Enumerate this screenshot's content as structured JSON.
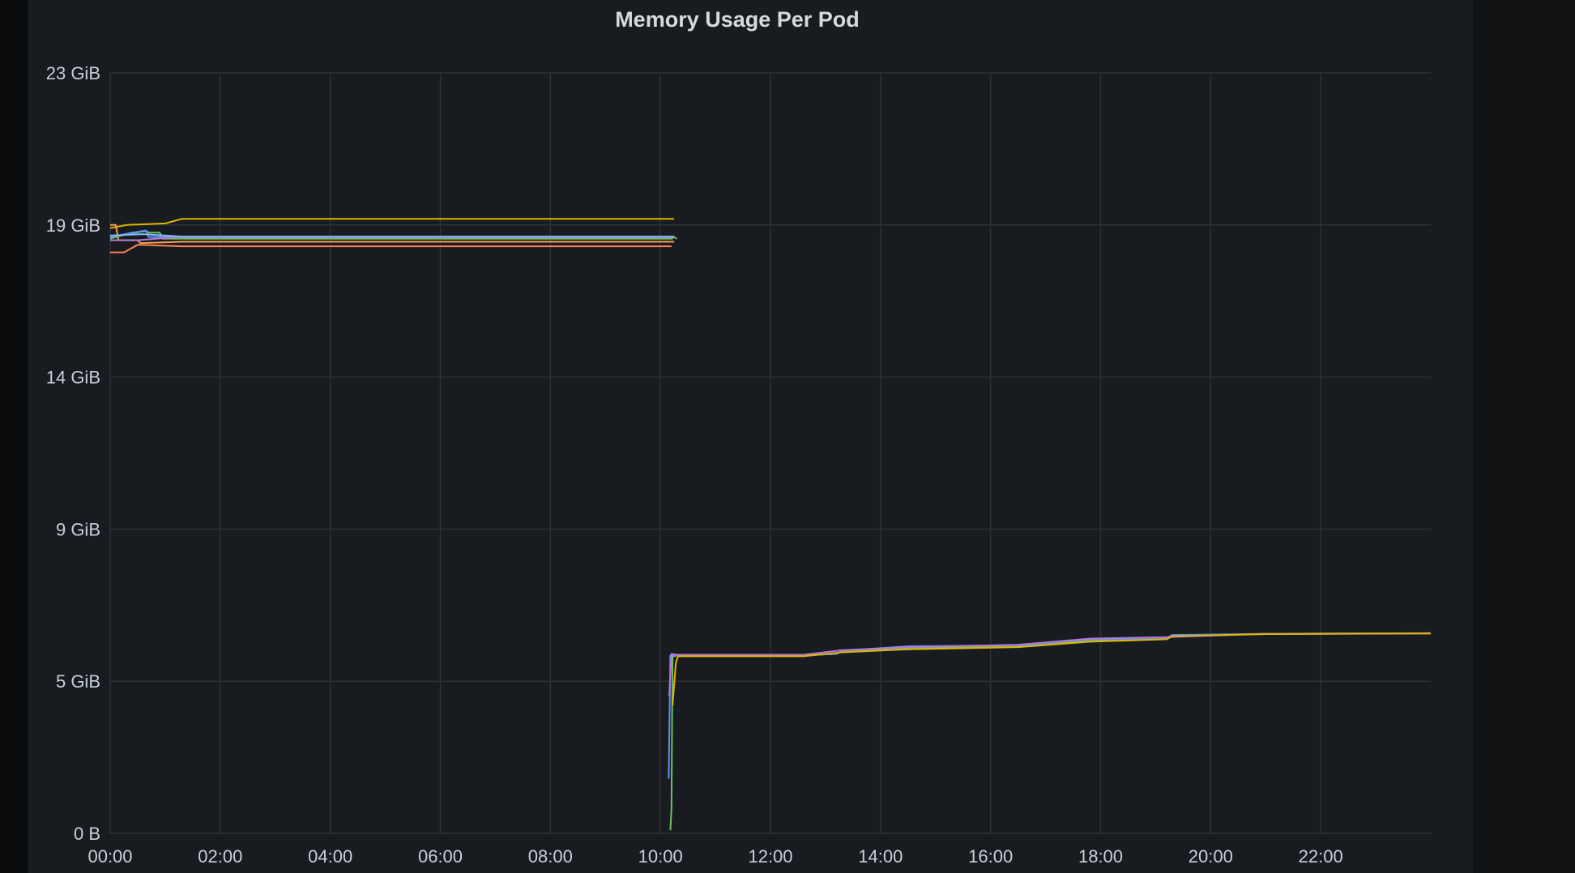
{
  "panel": {
    "title": "Memory Usage Per Pod"
  },
  "colors": {
    "background": "#181b1f",
    "grid": "#2f3136",
    "text": "#c7d0d9"
  },
  "chart_data": {
    "type": "line",
    "title": "Memory Usage Per Pod",
    "xlabel": "",
    "ylabel": "",
    "x_unit": "hours",
    "y_unit": "GiB",
    "xlim": [
      0,
      24
    ],
    "ylim": [
      0,
      25
    ],
    "grid": true,
    "legend": "none",
    "x_ticks": [
      {
        "value": 0,
        "label": "00:00"
      },
      {
        "value": 2,
        "label": "02:00"
      },
      {
        "value": 4,
        "label": "04:00"
      },
      {
        "value": 6,
        "label": "06:00"
      },
      {
        "value": 8,
        "label": "08:00"
      },
      {
        "value": 10,
        "label": "10:00"
      },
      {
        "value": 12,
        "label": "12:00"
      },
      {
        "value": 14,
        "label": "14:00"
      },
      {
        "value": 16,
        "label": "16:00"
      },
      {
        "value": 18,
        "label": "18:00"
      },
      {
        "value": 20,
        "label": "20:00"
      },
      {
        "value": 22,
        "label": "22:00"
      }
    ],
    "y_ticks": [
      {
        "value": 0,
        "label": "0 B"
      },
      {
        "value": 5,
        "label": "5 GiB"
      },
      {
        "value": 10,
        "label": "9 GiB"
      },
      {
        "value": 15,
        "label": "14 GiB"
      },
      {
        "value": 20,
        "label": "19 GiB"
      },
      {
        "value": 25,
        "label": "23 GiB"
      }
    ],
    "series": [
      {
        "color": "#e0b400",
        "points": [
          [
            0,
            19.9
          ],
          [
            0.3,
            20.0
          ],
          [
            1.0,
            20.05
          ],
          [
            1.3,
            20.2
          ],
          [
            10.25,
            20.2
          ]
        ]
      },
      {
        "color": "#f2a052",
        "points": [
          [
            0,
            20.0
          ],
          [
            0.1,
            20.0
          ],
          [
            0.15,
            19.5
          ],
          [
            0.5,
            19.5
          ],
          [
            0.55,
            19.4
          ],
          [
            1.3,
            19.45
          ],
          [
            10.25,
            19.45
          ]
        ]
      },
      {
        "color": "#73bf69",
        "points": [
          [
            0,
            19.55
          ],
          [
            0.3,
            19.7
          ],
          [
            0.65,
            19.8
          ],
          [
            0.7,
            19.75
          ],
          [
            0.9,
            19.75
          ],
          [
            0.95,
            19.55
          ],
          [
            10.2,
            19.55
          ],
          [
            10.25,
            19.6
          ],
          [
            10.3,
            19.55
          ]
        ]
      },
      {
        "color": "#5794f2",
        "points": [
          [
            0,
            19.6
          ],
          [
            0.4,
            19.75
          ],
          [
            0.65,
            19.82
          ],
          [
            0.7,
            19.6
          ],
          [
            1.3,
            19.6
          ],
          [
            10.2,
            19.6
          ]
        ]
      },
      {
        "color": "#b877d9",
        "points": [
          [
            0,
            19.5
          ],
          [
            0.5,
            19.5
          ],
          [
            1.2,
            19.6
          ],
          [
            10.2,
            19.6
          ]
        ]
      },
      {
        "color": "#8ab8ff",
        "points": [
          [
            0,
            19.65
          ],
          [
            0.6,
            19.7
          ],
          [
            1.3,
            19.62
          ],
          [
            10.25,
            19.62
          ]
        ]
      },
      {
        "color": "#ff7f50",
        "points": [
          [
            0,
            19.1
          ],
          [
            0.25,
            19.1
          ],
          [
            0.5,
            19.35
          ],
          [
            1.3,
            19.3
          ],
          [
            10.2,
            19.3
          ]
        ]
      },
      {
        "color": "#73bf69",
        "points": [
          [
            10.18,
            0.1
          ],
          [
            10.2,
            0.8
          ],
          [
            10.22,
            5.8
          ],
          [
            10.3,
            5.85
          ],
          [
            11.5,
            5.85
          ],
          [
            12.6,
            5.85
          ],
          [
            13.2,
            5.9
          ],
          [
            13.3,
            6.0
          ],
          [
            14.5,
            6.1
          ],
          [
            16.5,
            6.15
          ],
          [
            17.8,
            6.35
          ],
          [
            19.2,
            6.4
          ],
          [
            19.3,
            6.5
          ],
          [
            21.0,
            6.55
          ],
          [
            24.0,
            6.57
          ]
        ]
      },
      {
        "color": "#5794f2",
        "points": [
          [
            10.15,
            1.8
          ],
          [
            10.18,
            5.85
          ],
          [
            10.3,
            5.85
          ],
          [
            12.6,
            5.85
          ],
          [
            13.2,
            5.9
          ],
          [
            13.3,
            6.0
          ],
          [
            14.5,
            6.15
          ],
          [
            16.5,
            6.18
          ],
          [
            17.8,
            6.38
          ],
          [
            19.2,
            6.42
          ],
          [
            19.3,
            6.52
          ],
          [
            21.0,
            6.56
          ],
          [
            24.0,
            6.58
          ]
        ]
      },
      {
        "color": "#b877d9",
        "points": [
          [
            10.16,
            4.5
          ],
          [
            10.2,
            5.9
          ],
          [
            10.3,
            5.87
          ],
          [
            12.6,
            5.87
          ],
          [
            13.3,
            6.02
          ],
          [
            14.5,
            6.12
          ],
          [
            16.5,
            6.2
          ],
          [
            17.8,
            6.4
          ],
          [
            19.2,
            6.45
          ],
          [
            21.0,
            6.56
          ],
          [
            24.0,
            6.58
          ]
        ]
      },
      {
        "color": "#e0b400",
        "points": [
          [
            10.22,
            4.2
          ],
          [
            10.28,
            5.6
          ],
          [
            10.32,
            5.82
          ],
          [
            12.6,
            5.82
          ],
          [
            13.3,
            5.95
          ],
          [
            14.5,
            6.05
          ],
          [
            16.5,
            6.12
          ],
          [
            17.8,
            6.3
          ],
          [
            19.2,
            6.38
          ],
          [
            19.3,
            6.48
          ],
          [
            21.0,
            6.55
          ],
          [
            24.0,
            6.57
          ]
        ]
      }
    ]
  }
}
